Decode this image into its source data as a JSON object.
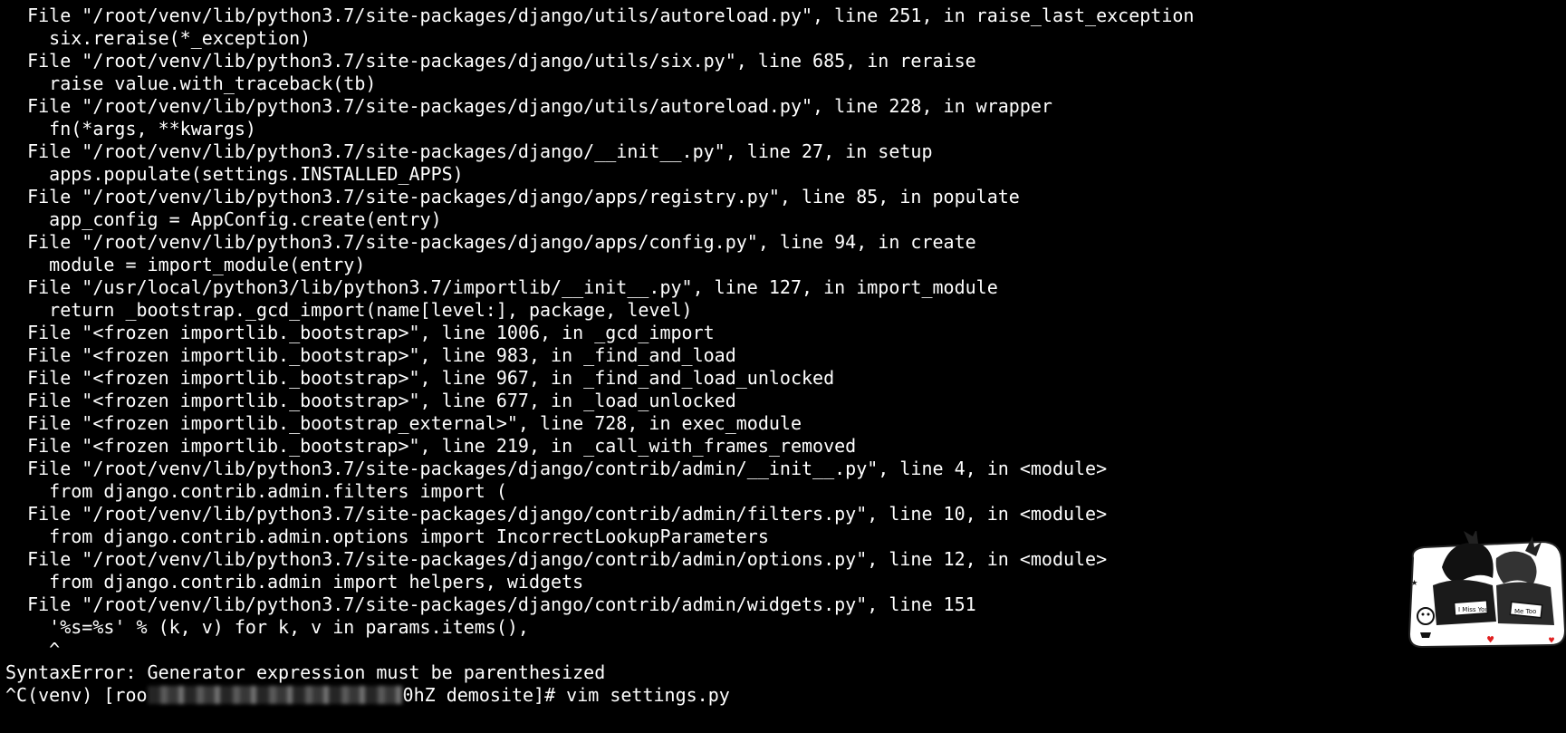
{
  "terminal": {
    "traceback_lines": [
      "  File \"/root/venv/lib/python3.7/site-packages/django/utils/autoreload.py\", line 251, in raise_last_exception",
      "    six.reraise(*_exception)",
      "  File \"/root/venv/lib/python3.7/site-packages/django/utils/six.py\", line 685, in reraise",
      "    raise value.with_traceback(tb)",
      "  File \"/root/venv/lib/python3.7/site-packages/django/utils/autoreload.py\", line 228, in wrapper",
      "    fn(*args, **kwargs)",
      "  File \"/root/venv/lib/python3.7/site-packages/django/__init__.py\", line 27, in setup",
      "    apps.populate(settings.INSTALLED_APPS)",
      "  File \"/root/venv/lib/python3.7/site-packages/django/apps/registry.py\", line 85, in populate",
      "    app_config = AppConfig.create(entry)",
      "  File \"/root/venv/lib/python3.7/site-packages/django/apps/config.py\", line 94, in create",
      "    module = import_module(entry)",
      "  File \"/usr/local/python3/lib/python3.7/importlib/__init__.py\", line 127, in import_module",
      "    return _bootstrap._gcd_import(name[level:], package, level)",
      "  File \"<frozen importlib._bootstrap>\", line 1006, in _gcd_import",
      "  File \"<frozen importlib._bootstrap>\", line 983, in _find_and_load",
      "  File \"<frozen importlib._bootstrap>\", line 967, in _find_and_load_unlocked",
      "  File \"<frozen importlib._bootstrap>\", line 677, in _load_unlocked",
      "  File \"<frozen importlib._bootstrap_external>\", line 728, in exec_module",
      "  File \"<frozen importlib._bootstrap>\", line 219, in _call_with_frames_removed",
      "  File \"/root/venv/lib/python3.7/site-packages/django/contrib/admin/__init__.py\", line 4, in <module>",
      "    from django.contrib.admin.filters import (",
      "  File \"/root/venv/lib/python3.7/site-packages/django/contrib/admin/filters.py\", line 10, in <module>",
      "    from django.contrib.admin.options import IncorrectLookupParameters",
      "  File \"/root/venv/lib/python3.7/site-packages/django/contrib/admin/options.py\", line 12, in <module>",
      "    from django.contrib.admin import helpers, widgets",
      "  File \"/root/venv/lib/python3.7/site-packages/django/contrib/admin/widgets.py\", line 151",
      "    '%s=%s' % (k, v) for k, v in params.items(),",
      "    ^"
    ],
    "error_message": "SyntaxError: Generator expression must be parenthesized",
    "prompt_prefix": "^C(venv) [roo",
    "prompt_suffix": "0hZ demosite]# ",
    "command": "vim settings.py",
    "text_color": "#ffffff",
    "background_color": "#000000"
  },
  "sticker": {
    "icon": "couple-sticker-icon",
    "label_left": "I Miss You",
    "label_right": "Me Too"
  }
}
